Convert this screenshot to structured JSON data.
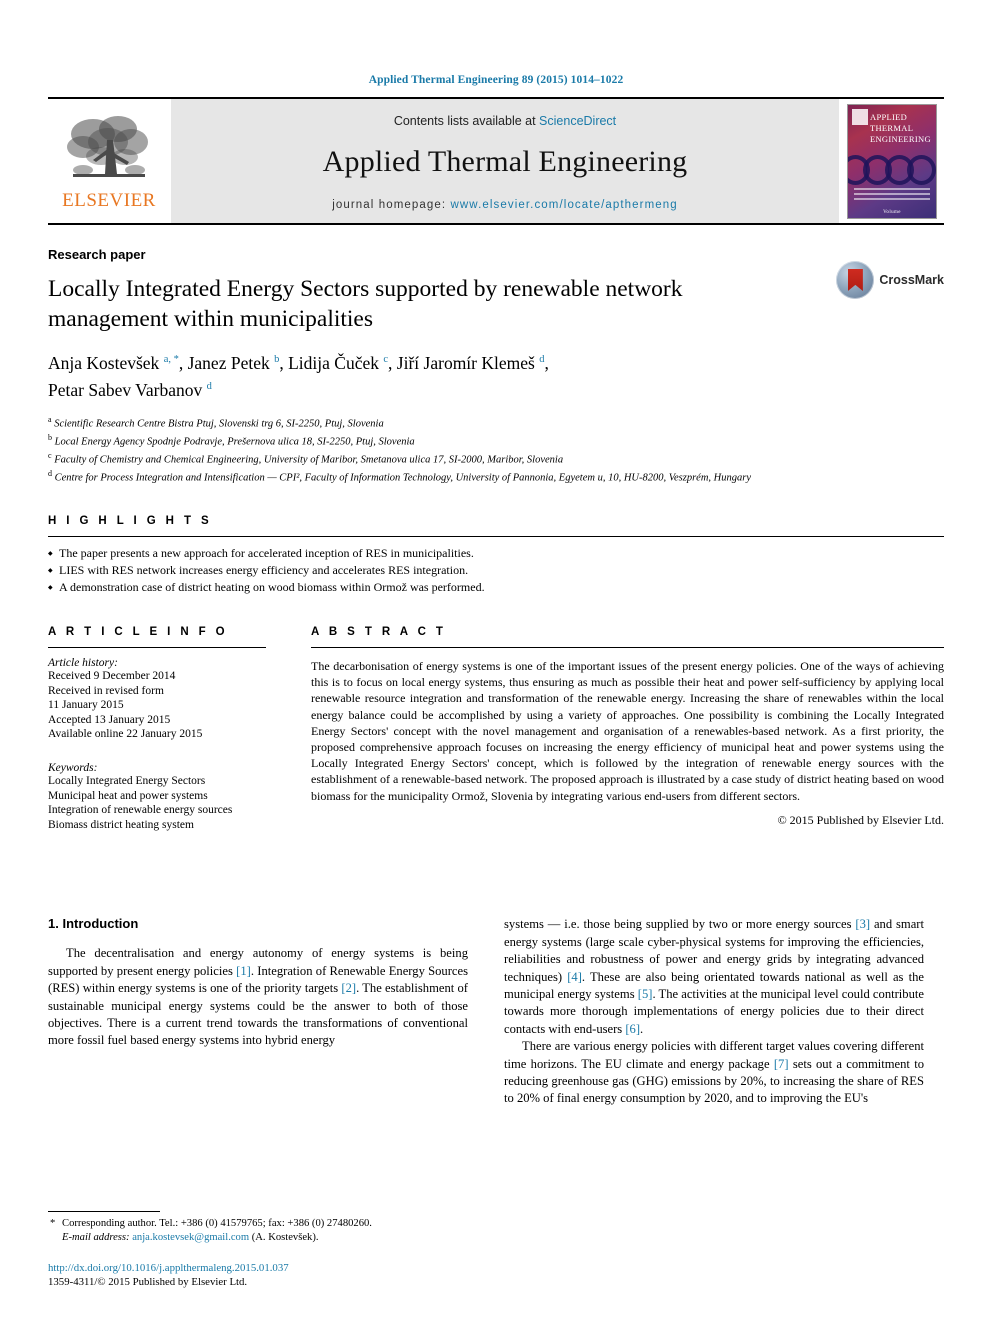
{
  "running_head": "Applied Thermal Engineering 89 (2015) 1014–1022",
  "colors": {
    "link_blue": "#1a7aa8",
    "elsevier_orange": "#E87722",
    "masthead_grey": "#e6e6e6",
    "crossmark_red": "#cf2b20"
  },
  "masthead": {
    "publisher_name": "ELSEVIER",
    "contents_prefix": "Contents lists available at ",
    "contents_link": "ScienceDirect",
    "journal_name": "Applied Thermal Engineering",
    "homepage_prefix": "journal homepage: ",
    "homepage_url": "www.elsevier.com/locate/apthermeng",
    "cover": {
      "line1": "APPLIED",
      "line2": "THERMAL",
      "line3": "ENGINEERING",
      "bottom": "Volume"
    }
  },
  "article": {
    "kicker": "Research paper",
    "title": "Locally Integrated Energy Sectors supported by renewable network management within municipalities",
    "crossmark_label": "CrossMark",
    "authors": [
      {
        "name": "Anja Kostevšek",
        "marks": "a, *",
        "sep": ", "
      },
      {
        "name": "Janez Petek",
        "marks": "b",
        "sep": ", "
      },
      {
        "name": "Lidija Čuček",
        "marks": "c",
        "sep": ", "
      },
      {
        "name": "Jiří Jaromír Klemeš",
        "marks": "d",
        "sep": ", "
      },
      {
        "name": "Petar Sabev Varbanov",
        "marks": "d",
        "sep": ""
      }
    ],
    "affiliations": [
      {
        "mark": "a",
        "text": "Scientific Research Centre Bistra Ptuj, Slovenski trg 6, SI-2250, Ptuj, Slovenia"
      },
      {
        "mark": "b",
        "text": "Local Energy Agency Spodnje Podravje, Prešernova ulica 18, SI-2250, Ptuj, Slovenia"
      },
      {
        "mark": "c",
        "text": "Faculty of Chemistry and Chemical Engineering, University of Maribor, Smetanova ulica 17, SI-2000, Maribor, Slovenia"
      },
      {
        "mark": "d",
        "text": "Centre for Process Integration and Intensification — CPI², Faculty of Information Technology, University of Pannonia, Egyetem u, 10, HU-8200, Veszprém, Hungary"
      }
    ]
  },
  "highlights": {
    "heading": "H I G H L I G H T S",
    "items": [
      "The paper presents a new approach for accelerated inception of RES in municipalities.",
      "LIES with RES network increases energy efficiency and accelerates RES integration.",
      "A demonstration case of district heating on wood biomass within Ormož was performed."
    ]
  },
  "article_info": {
    "heading": "A R T I C L E   I N F O",
    "history_label": "Article history:",
    "history": [
      "Received 9 December 2014",
      "Received in revised form",
      "11 January 2015",
      "Accepted 13 January 2015",
      "Available online 22 January 2015"
    ],
    "keywords_label": "Keywords:",
    "keywords": [
      "Locally Integrated Energy Sectors",
      "Municipal heat and power systems",
      "Integration of renewable energy sources",
      "Biomass district heating system"
    ]
  },
  "abstract": {
    "heading": "A B S T R A C T",
    "text": "The decarbonisation of energy systems is one of the important issues of the present energy policies. One of the ways of achieving this is to focus on local energy systems, thus ensuring as much as possible their heat and power self-sufficiency by applying local renewable resource integration and transformation of the renewable energy. Increasing the share of renewables within the local energy balance could be accomplished by using a variety of approaches. One possibility is combining the Locally Integrated Energy Sectors' concept with the novel management and organisation of a renewables-based network. As a first priority, the proposed comprehensive approach focuses on increasing the energy efficiency of municipal heat and power systems using the Locally Integrated Energy Sectors' concept, which is followed by the integration of renewable energy sources with the establishment of a renewable-based network. The proposed approach is illustrated by a case study of district heating based on wood biomass for the municipality Ormož, Slovenia by integrating various end-users from different sectors.",
    "copyright": "© 2015 Published by Elsevier Ltd."
  },
  "body": {
    "section_number_title": "1. Introduction",
    "left_paragraphs": [
      "The decentralisation and energy autonomy of energy systems is being supported by present energy policies [1]. Integration of Renewable Energy Sources (RES) within energy systems is one of the priority targets [2]. The establishment of sustainable municipal energy systems could be the answer to both of those objectives. There is a current trend towards the transformations of conventional more fossil fuel based energy systems into hybrid energy"
    ],
    "right_paragraphs": [
      "systems — i.e. those being supplied by two or more energy sources [3] and smart energy systems (large scale cyber-physical systems for improving the efficiencies, reliabilities and robustness of power and energy grids by integrating advanced techniques) [4]. These are also being orientated towards national as well as the municipal energy systems [5]. The activities at the municipal level could contribute towards more thorough implementations of energy policies due to their direct contacts with end-users [6].",
      "There are various energy policies with different target values covering different time horizons. The EU climate and energy package [7] sets out a commitment to reducing greenhouse gas (GHG) emissions by 20%, to increasing the share of RES to 20% of final energy consumption by 2020, and to improving the EU's"
    ]
  },
  "footer": {
    "corresponding_star": "*",
    "corresponding_text": "Corresponding author. Tel.: +386 (0) 41579765; fax: +386 (0) 27480260.",
    "email_label": "E-mail address:",
    "email": "anja.kostevsek@gmail.com",
    "email_suffix": "(A. Kostevšek).",
    "doi": "http://dx.doi.org/10.1016/j.applthermaleng.2015.01.037",
    "issn": "1359-4311/© 2015 Published by Elsevier Ltd."
  }
}
